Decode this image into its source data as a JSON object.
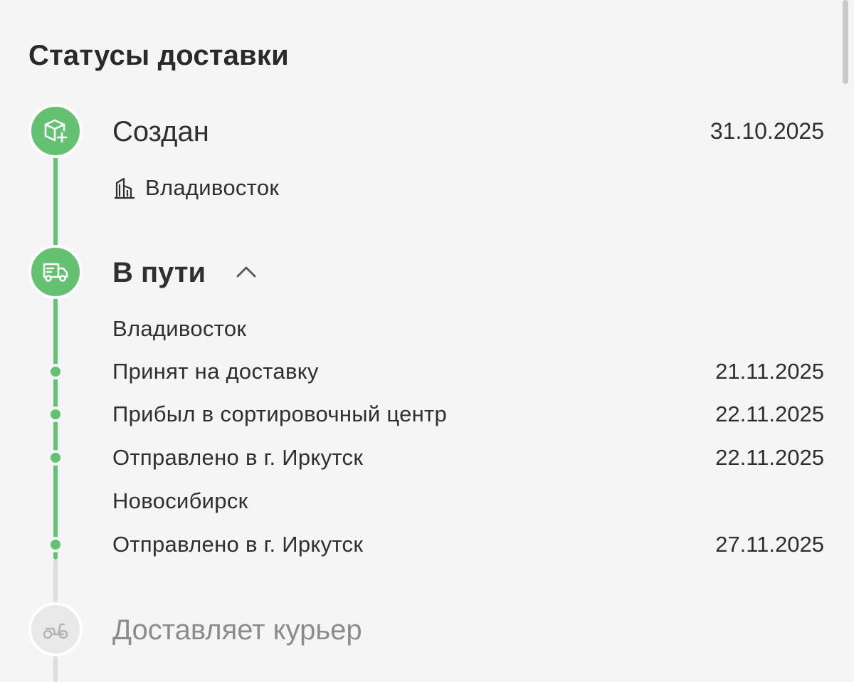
{
  "header": {
    "title": "Статусы доставки"
  },
  "steps": {
    "created": {
      "label": "Создан",
      "date": "31.10.2025",
      "city": "Владивосток",
      "icon": "package-plus-icon"
    },
    "in_transit": {
      "label": "В пути",
      "icon": "delivery-truck-icon",
      "expanded": true,
      "groups": [
        {
          "city": "Владивосток",
          "events": [
            {
              "label": "Принят на доставку",
              "date": "21.11.2025"
            },
            {
              "label": "Прибыл в сортировочный центр",
              "date": "22.11.2025"
            },
            {
              "label": "Отправлено в г. Иркутск",
              "date": "22.11.2025"
            }
          ]
        },
        {
          "city": "Новосибирск",
          "events": [
            {
              "label": "Отправлено в г. Иркутск",
              "date": "27.11.2025"
            }
          ]
        }
      ]
    },
    "courier": {
      "label": "Доставляет курьер",
      "icon": "scooter-icon"
    }
  },
  "colors": {
    "done": "#64c172",
    "pending": "#e9e9e9",
    "pending_text": "#8c8c8c",
    "text": "#2f2f2f",
    "background": "#f5f5f5"
  }
}
